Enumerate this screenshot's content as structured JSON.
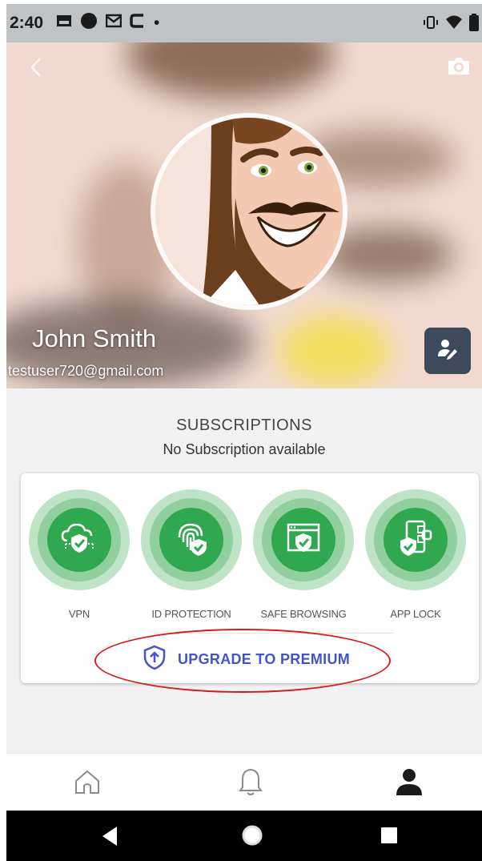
{
  "status_bar": {
    "time": "2:40",
    "dot": "•"
  },
  "profile": {
    "name": "John  Smith",
    "email": "testuser720@gmail.com"
  },
  "subscriptions": {
    "title": "SUBSCRIPTIONS",
    "message": "No Subscription available"
  },
  "features": [
    {
      "label": "VPN",
      "icon": "cloud-shield-icon"
    },
    {
      "label": "ID PROTECTION",
      "icon": "fingerprint-shield-icon"
    },
    {
      "label": "SAFE BROWSING",
      "icon": "browser-shield-icon"
    },
    {
      "label": "APP LOCK",
      "icon": "apps-shield-icon"
    }
  ],
  "upgrade": {
    "label": "UPGRADE TO PREMIUM",
    "icon": "shield-arrow-up-icon"
  },
  "bottom_nav": {
    "items": [
      "home-icon",
      "bell-icon",
      "profile-icon"
    ],
    "active": "profile-icon"
  },
  "colors": {
    "accent": "#4354c9",
    "feature_green": "#2fa84f",
    "annotation_red": "#d91818",
    "edit_button": "#3d4a5c"
  }
}
